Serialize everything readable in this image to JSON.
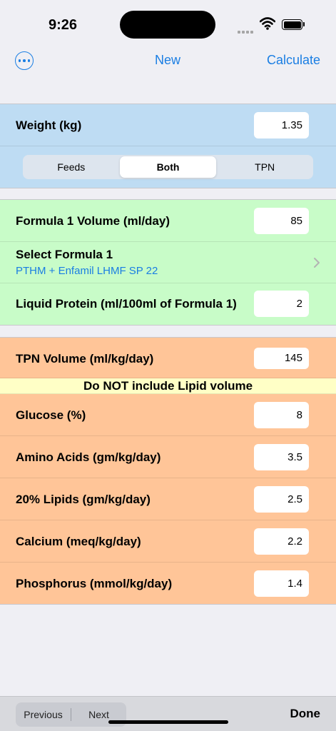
{
  "status_bar": {
    "time": "9:26",
    "icons": [
      "cellular-signal-icon",
      "wifi-icon",
      "battery-icon"
    ]
  },
  "nav": {
    "more_icon": "ellipsis-circle-icon",
    "new_label": "New",
    "calculate_label": "Calculate",
    "accent_color": "#1a7ee3"
  },
  "weight_section": {
    "weight_label": "Weight (kg)",
    "weight_value": "1.35",
    "segments": [
      "Feeds",
      "Both",
      "TPN"
    ],
    "selected_segment": "Both",
    "background_color": "#bedcf3"
  },
  "feeds_section": {
    "formula1_volume_label": "Formula 1 Volume (ml/day)",
    "formula1_volume_value": "85",
    "select_formula_label": "Select Formula 1",
    "selected_formula": "PTHM + Enfamil LHMF SP 22",
    "chevron_icon": "chevron-right-icon",
    "liquid_protein_label": "Liquid Protein (ml/100ml of Formula 1)",
    "liquid_protein_value": "2",
    "background_color": "#c8fcc8"
  },
  "tpn_section": {
    "tpn_volume_label": "TPN Volume (ml/kg/day)",
    "tpn_volume_value": "145",
    "warning": "Do NOT include Lipid volume",
    "glucose_label": "Glucose (%)",
    "glucose_value": "8",
    "amino_label": "Amino Acids (gm/kg/day)",
    "amino_value": "3.5",
    "lipids_label": "20% Lipids (gm/kg/day)",
    "lipids_value": "2.5",
    "calcium_label": "Calcium (meq/kg/day)",
    "calcium_value": "2.2",
    "phosphorus_label": "Phosphorus (mmol/kg/day)",
    "phosphorus_value": "1.4",
    "background_color": "#ffc598",
    "warning_color": "#ffffc6"
  },
  "keyboard_toolbar": {
    "previous_label": "Previous",
    "next_label": "Next",
    "done_label": "Done"
  }
}
